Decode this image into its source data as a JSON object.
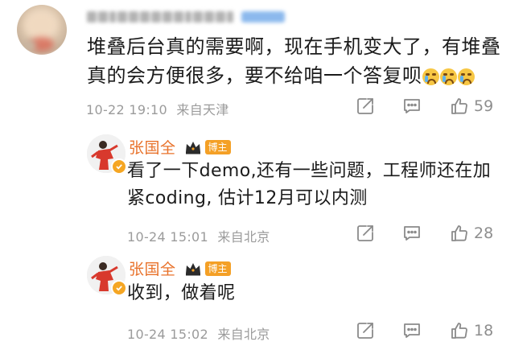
{
  "main_comment": {
    "text": "堆叠后台真的需要啊，现在手机变大了，有堆叠真的会方便很多，要不给咱一个答复呗",
    "emoji_count": 3,
    "time": "10-22 19:10",
    "location": "来自天津",
    "likes": "59"
  },
  "replies": [
    {
      "name": "张国全",
      "badge": "博主",
      "text": "看了一下demo,还有一些问题，工程师还在加紧coding, 估计12月可以内测",
      "time": "10-24 15:01",
      "location": "来自北京",
      "likes": "28"
    },
    {
      "name": "张国全",
      "badge": "博主",
      "text": "收到，做着呢",
      "time": "10-24 15:02",
      "location": "来自北京",
      "likes": "18"
    }
  ],
  "icons": {
    "share": "share-icon",
    "comment": "comment-icon",
    "like": "thumbs-up-icon",
    "crown": "crown-icon",
    "verified": "verified-badge-icon"
  },
  "colors": {
    "name": "#e8722b",
    "badge": "#f4a026",
    "meta": "#9b9b9b"
  }
}
